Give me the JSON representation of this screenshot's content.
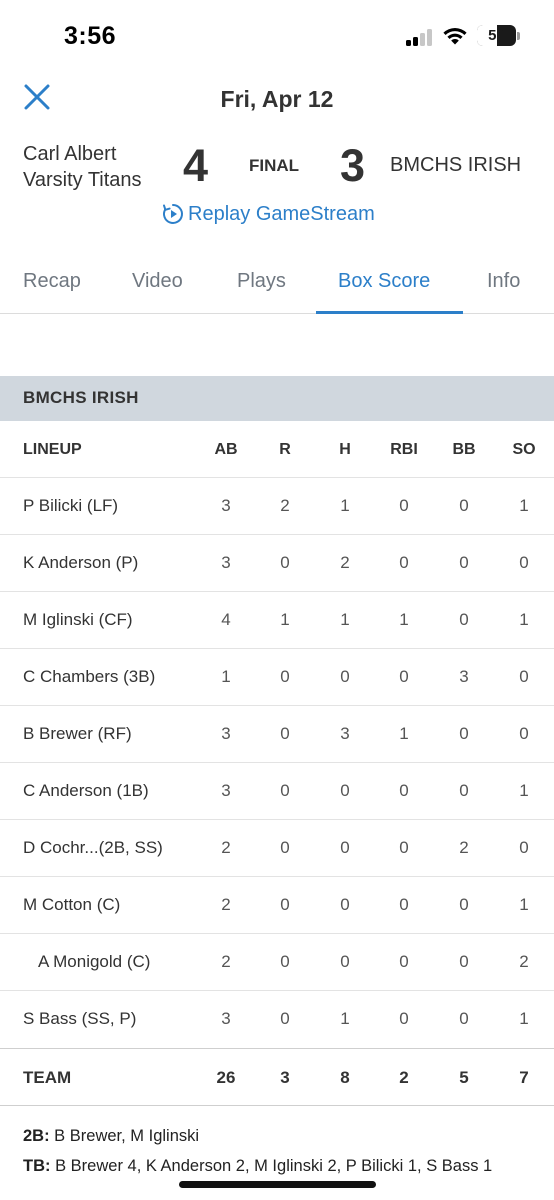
{
  "status_bar": {
    "time": "3:56",
    "battery_percent": "50",
    "battery_level": 0.5
  },
  "header": {
    "date": "Fri, Apr 12"
  },
  "scoreboard": {
    "home_team_line1": "Carl Albert",
    "home_team_line2": "Varsity Titans",
    "home_score": "4",
    "status": "FINAL",
    "away_score": "3",
    "away_team": "BMCHS IRISH",
    "replay_label": "Replay GameStream"
  },
  "tabs": [
    {
      "label": "Recap",
      "active": false
    },
    {
      "label": "Video",
      "active": false
    },
    {
      "label": "Plays",
      "active": false
    },
    {
      "label": "Box Score",
      "active": true
    },
    {
      "label": "Info",
      "active": false
    }
  ],
  "box_score": {
    "team_name": "BMCHS IRISH",
    "columns": [
      "LINEUP",
      "AB",
      "R",
      "H",
      "RBI",
      "BB",
      "SO"
    ],
    "players": [
      {
        "name": "P Bilicki (LF)",
        "sub": false,
        "stats": [
          "3",
          "2",
          "1",
          "0",
          "0",
          "1"
        ]
      },
      {
        "name": "K Anderson (P)",
        "sub": false,
        "stats": [
          "3",
          "0",
          "2",
          "0",
          "0",
          "0"
        ]
      },
      {
        "name": "M Iglinski (CF)",
        "sub": false,
        "stats": [
          "4",
          "1",
          "1",
          "1",
          "0",
          "1"
        ]
      },
      {
        "name": "C Chambers (3B)",
        "sub": false,
        "stats": [
          "1",
          "0",
          "0",
          "0",
          "3",
          "0"
        ]
      },
      {
        "name": "B Brewer (RF)",
        "sub": false,
        "stats": [
          "3",
          "0",
          "3",
          "1",
          "0",
          "0"
        ]
      },
      {
        "name": "C Anderson (1B)",
        "sub": false,
        "stats": [
          "3",
          "0",
          "0",
          "0",
          "0",
          "1"
        ]
      },
      {
        "name": "D Cochr...(2B, SS)",
        "sub": false,
        "stats": [
          "2",
          "0",
          "0",
          "0",
          "2",
          "0"
        ]
      },
      {
        "name": "M Cotton (C)",
        "sub": false,
        "stats": [
          "2",
          "0",
          "0",
          "0",
          "0",
          "1"
        ]
      },
      {
        "name": "A Monigold (C)",
        "sub": true,
        "stats": [
          "2",
          "0",
          "0",
          "0",
          "0",
          "2"
        ]
      },
      {
        "name": "S Bass (SS, P)",
        "sub": false,
        "stats": [
          "3",
          "0",
          "1",
          "0",
          "0",
          "1"
        ]
      }
    ],
    "totals": {
      "label": "TEAM",
      "stats": [
        "26",
        "3",
        "8",
        "2",
        "5",
        "7"
      ]
    }
  },
  "notes": [
    {
      "label": "2B:",
      "text": " B Brewer, M Iglinski"
    },
    {
      "label": "TB:",
      "text": " B Brewer 4, K Anderson 2, M Iglinski 2, P Bilicki 1, S Bass 1"
    }
  ],
  "colors": {
    "accent": "#2c7fc9",
    "team_header_bg": "#d0d7de",
    "text": "#333333",
    "tab_inactive": "#6f7780"
  }
}
